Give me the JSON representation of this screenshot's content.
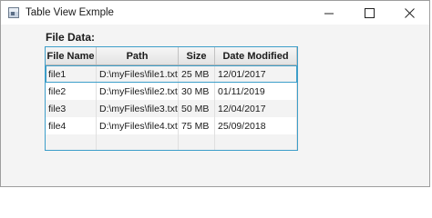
{
  "window": {
    "title": "Table View Exmple",
    "minimize_symbol": "—",
    "maximize_symbol": "☐",
    "close_symbol": "✕"
  },
  "label": "File Data:",
  "table": {
    "columns": [
      "File Name",
      "Path",
      "Size",
      "Date Modified"
    ],
    "rows": [
      {
        "name": "file1",
        "path": "D:\\myFiles\\file1.txt",
        "size": "25 MB",
        "date": "12/01/2017"
      },
      {
        "name": "file2",
        "path": "D:\\myFiles\\file2.txt",
        "size": "30 MB",
        "date": "01/11/2019"
      },
      {
        "name": "file3",
        "path": "D:\\myFiles\\file3.txt",
        "size": "50 MB",
        "date": "12/04/2017"
      },
      {
        "name": "file4",
        "path": "D:\\myFiles\\file4.txt",
        "size": "75 MB",
        "date": "25/09/2018"
      }
    ]
  }
}
